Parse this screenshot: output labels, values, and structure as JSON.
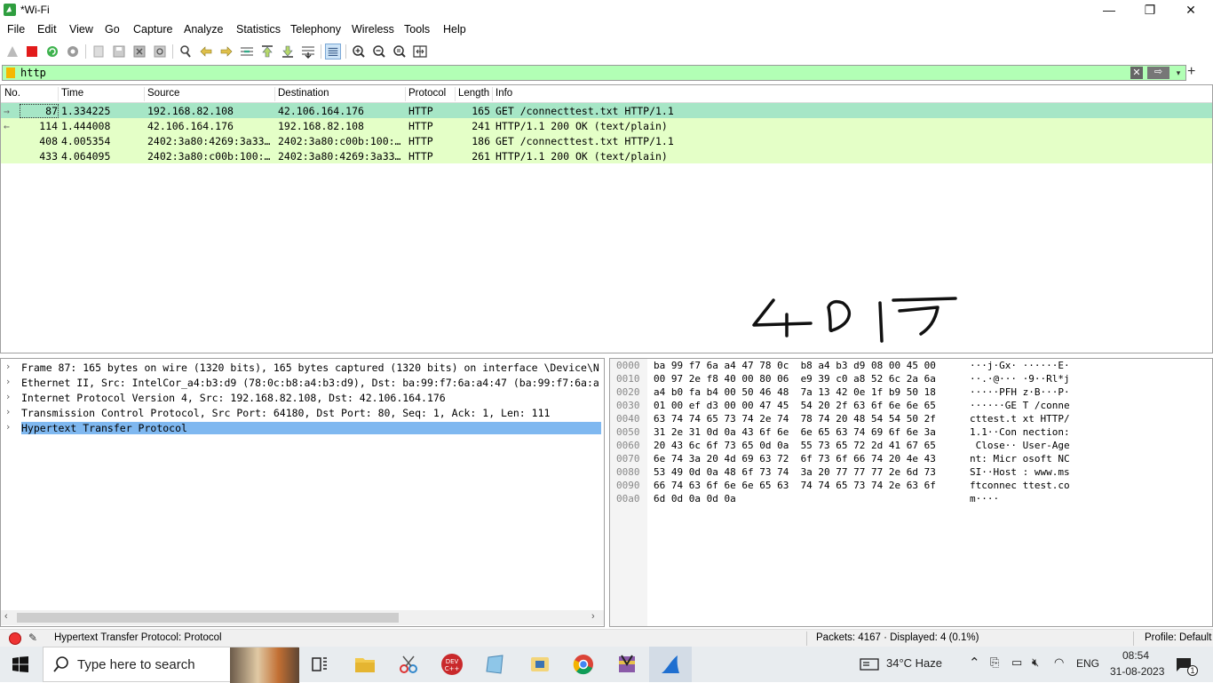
{
  "window": {
    "title": "*Wi-Fi",
    "minimize": "—",
    "maximize": "❐",
    "close": "✕"
  },
  "menu": [
    "File",
    "Edit",
    "View",
    "Go",
    "Capture",
    "Analyze",
    "Statistics",
    "Telephony",
    "Wireless",
    "Tools",
    "Help"
  ],
  "filter": {
    "value": "http",
    "clear": "✕",
    "apply": "⇨",
    "dropdown": "▾",
    "add": "+"
  },
  "packet_list": {
    "columns": [
      "No.",
      "Time",
      "Source",
      "Destination",
      "Protocol",
      "Length",
      "Info"
    ],
    "rows": [
      {
        "no": "87",
        "time": "1.334225",
        "source": "192.168.82.108",
        "destination": "42.106.164.176",
        "protocol": "HTTP",
        "length": "165",
        "info": "GET /connecttest.txt HTTP/1.1",
        "selected": true
      },
      {
        "no": "114",
        "time": "1.444008",
        "source": "42.106.164.176",
        "destination": "192.168.82.108",
        "protocol": "HTTP",
        "length": "241",
        "info": "HTTP/1.1 200 OK  (text/plain)"
      },
      {
        "no": "408",
        "time": "4.005354",
        "source": "2402:3a80:4269:3a33…",
        "destination": "2402:3a80:c00b:100:…",
        "protocol": "HTTP",
        "length": "186",
        "info": "GET /connecttest.txt HTTP/1.1"
      },
      {
        "no": "433",
        "time": "4.064095",
        "source": "2402:3a80:c00b:100:…",
        "destination": "2402:3a80:4269:3a33…",
        "protocol": "HTTP",
        "length": "261",
        "info": "HTTP/1.1 200 OK  (text/plain)"
      }
    ]
  },
  "details": [
    "Frame 87: 165 bytes on wire (1320 bits), 165 bytes captured (1320 bits) on interface \\Device\\N",
    "Ethernet II, Src: IntelCor_a4:b3:d9 (78:0c:b8:a4:b3:d9), Dst: ba:99:f7:6a:a4:47 (ba:99:f7:6a:a",
    "Internet Protocol Version 4, Src: 192.168.82.108, Dst: 42.106.164.176",
    "Transmission Control Protocol, Src Port: 64180, Dst Port: 80, Seq: 1, Ack: 1, Len: 111",
    "Hypertext Transfer Protocol"
  ],
  "bytes": [
    {
      "off": "0000",
      "hex": "ba 99 f7 6a a4 47 78 0c  b8 a4 b3 d9 08 00 45 00",
      "asc": "···j·Gx· ······E·"
    },
    {
      "off": "0010",
      "hex": "00 97 2e f8 40 00 80 06  e9 39 c0 a8 52 6c 2a 6a",
      "asc": "··.·@··· ·9··Rl*j"
    },
    {
      "off": "0020",
      "hex": "a4 b0 fa b4 00 50 46 48  7a 13 42 0e 1f b9 50 18",
      "asc": "·····PFH z·B···P·"
    },
    {
      "off": "0030",
      "hex": "01 00 ef d3 00 00 47 45  54 20 2f 63 6f 6e 6e 65",
      "asc": "······GE T /conne"
    },
    {
      "off": "0040",
      "hex": "63 74 74 65 73 74 2e 74  78 74 20 48 54 54 50 2f",
      "asc": "cttest.t xt HTTP/"
    },
    {
      "off": "0050",
      "hex": "31 2e 31 0d 0a 43 6f 6e  6e 65 63 74 69 6f 6e 3a",
      "asc": "1.1··Con nection:"
    },
    {
      "off": "0060",
      "hex": "20 43 6c 6f 73 65 0d 0a  55 73 65 72 2d 41 67 65",
      "asc": " Close·· User-Age"
    },
    {
      "off": "0070",
      "hex": "6e 74 3a 20 4d 69 63 72  6f 73 6f 66 74 20 4e 43",
      "asc": "nt: Micr osoft NC"
    },
    {
      "off": "0080",
      "hex": "53 49 0d 0a 48 6f 73 74  3a 20 77 77 77 2e 6d 73",
      "asc": "SI··Host : www.ms"
    },
    {
      "off": "0090",
      "hex": "66 74 63 6f 6e 6e 65 63  74 74 65 73 74 2e 63 6f",
      "asc": "ftconnec ttest.co"
    },
    {
      "off": "00a0",
      "hex": "6d 0d 0a 0d 0a",
      "asc": "m····"
    }
  ],
  "status": {
    "field": "Hypertext Transfer Protocol: Protocol",
    "packets": "Packets: 4167 · Displayed: 4 (0.1%)",
    "profile": "Profile: Default"
  },
  "taskbar": {
    "search_placeholder": "Type here to search",
    "weather": "34°C  Haze",
    "language": "ENG",
    "time": "08:54",
    "date": "31-08-2023",
    "notifications": "1"
  },
  "colors": {
    "filter_ok": "#b2ffb5",
    "row_http": "#e4ffc7",
    "row_selected": "#a6e6c6",
    "detail_selected": "#7fb8f0"
  }
}
